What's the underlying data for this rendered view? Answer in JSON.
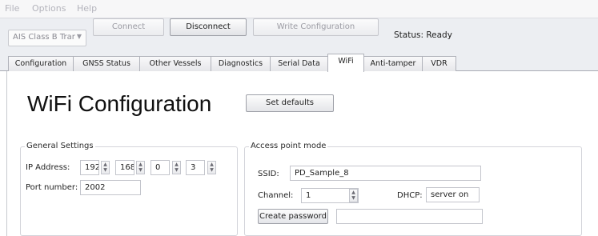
{
  "menu": {
    "file": "File",
    "options": "Options",
    "help": "Help"
  },
  "toolbar": {
    "device_select": "AIS Class B Trar",
    "device_arrow": "▼",
    "connect": "Connect",
    "disconnect": "Disconnect",
    "write_config": "Write Configuration",
    "status": "Status: Ready"
  },
  "tabs": [
    {
      "label": "Configuration"
    },
    {
      "label": "GNSS Status"
    },
    {
      "label": "Other Vessels"
    },
    {
      "label": "Diagnostics"
    },
    {
      "label": "Serial Data"
    },
    {
      "label": "WiFi"
    },
    {
      "label": "Anti-tamper"
    },
    {
      "label": "VDR"
    }
  ],
  "selected_tab": "WiFi",
  "page": {
    "title": "WiFi Configuration",
    "set_defaults": "Set defaults"
  },
  "general": {
    "title": "General Settings",
    "ip_label": "IP Address:",
    "ip": [
      "192",
      "168",
      "0",
      "3"
    ],
    "port_label": "Port number:",
    "port": "2002"
  },
  "ap": {
    "title": "Access point mode",
    "ssid_label": "SSID:",
    "ssid": "PD_Sample_8",
    "channel_label": "Channel:",
    "channel": "1",
    "dhcp_label": "DHCP:",
    "dhcp": "server on",
    "create_password": "Create password",
    "password": ""
  },
  "icons": {
    "spin_up": "▲",
    "spin_down": "▼"
  }
}
